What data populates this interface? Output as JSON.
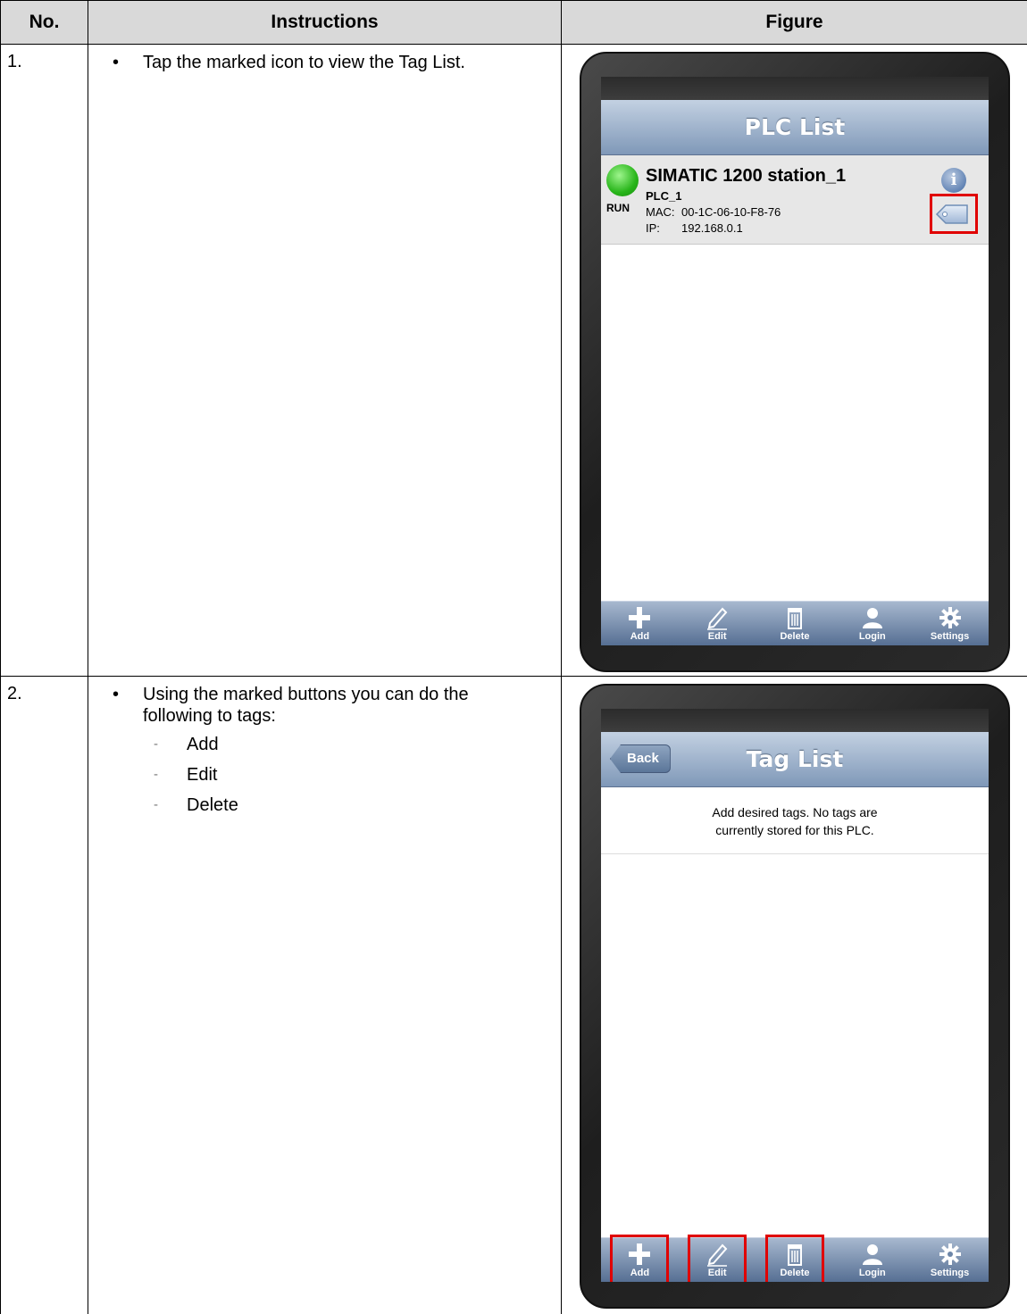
{
  "table": {
    "headers": [
      "No.",
      "Instructions",
      "Figure"
    ],
    "rows": [
      {
        "no": "1.",
        "instruction": "Tap the marked icon to view the Tag List.",
        "figure": {
          "title": "PLC List",
          "station_name": "SIMATIC 1200 station_1",
          "plc_name": "PLC_1",
          "status": "RUN",
          "mac_label": "MAC:",
          "mac_value": "00-1C-06-10-F8-76",
          "ip_label": "IP:",
          "ip_value": "192.168.0.1",
          "status_color": "#28b51a",
          "highlight_color": "#e00000",
          "tabs": [
            "Add",
            "Edit",
            "Delete",
            "Login",
            "Settings"
          ]
        }
      },
      {
        "no": "2.",
        "instruction": "Using the marked buttons you can do the following to tags:",
        "sub_items": [
          "Add",
          "Edit",
          "Delete"
        ],
        "figure": {
          "back_label": "Back",
          "title": "Tag List",
          "message_line1": "Add desired tags.  No tags are",
          "message_line2": "currently stored for this PLC.",
          "tabs": [
            "Add",
            "Edit",
            "Delete",
            "Login",
            "Settings"
          ]
        }
      }
    ]
  }
}
